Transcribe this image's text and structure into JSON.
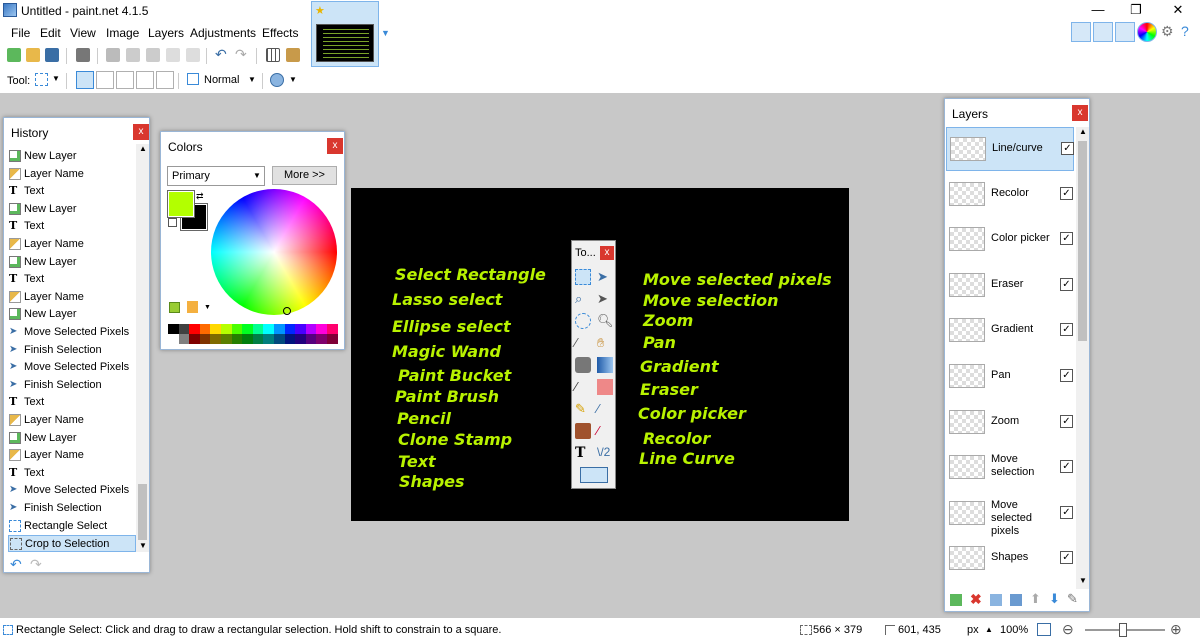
{
  "window": {
    "title": "Untitled - paint.net 4.1.5",
    "minimize": "—",
    "maximize": "❐",
    "close": "✕"
  },
  "menu": [
    "File",
    "Edit",
    "View",
    "Image",
    "Layers",
    "Adjustments",
    "Effects"
  ],
  "tool_options": {
    "tool_label": "Tool:",
    "blend_mode": "Normal"
  },
  "history": {
    "title": "History",
    "close": "x",
    "items": [
      {
        "label": "New Layer",
        "icon": "new-layer-icon"
      },
      {
        "label": "Layer Name",
        "icon": "layer-properties-icon"
      },
      {
        "label": "Text",
        "icon": "text-tool-icon"
      },
      {
        "label": "New Layer",
        "icon": "new-layer-icon"
      },
      {
        "label": "Text",
        "icon": "text-tool-icon"
      },
      {
        "label": "Layer Name",
        "icon": "layer-properties-icon"
      },
      {
        "label": "New Layer",
        "icon": "new-layer-icon"
      },
      {
        "label": "Text",
        "icon": "text-tool-icon"
      },
      {
        "label": "Layer Name",
        "icon": "layer-properties-icon"
      },
      {
        "label": "New Layer",
        "icon": "new-layer-icon"
      },
      {
        "label": "Move Selected Pixels",
        "icon": "move-selected-icon"
      },
      {
        "label": "Finish Selection",
        "icon": "finish-selection-icon"
      },
      {
        "label": "Move Selected Pixels",
        "icon": "move-selected-icon"
      },
      {
        "label": "Finish Selection",
        "icon": "finish-selection-icon"
      },
      {
        "label": "Text",
        "icon": "text-tool-icon"
      },
      {
        "label": "Layer Name",
        "icon": "layer-properties-icon"
      },
      {
        "label": "New Layer",
        "icon": "new-layer-icon"
      },
      {
        "label": "Layer Name",
        "icon": "layer-properties-icon"
      },
      {
        "label": "Text",
        "icon": "text-tool-icon"
      },
      {
        "label": "Move Selected Pixels",
        "icon": "move-selected-icon"
      },
      {
        "label": "Finish Selection",
        "icon": "finish-selection-icon"
      },
      {
        "label": "Rectangle Select",
        "icon": "rectangle-select-icon"
      },
      {
        "label": "Crop to Selection",
        "icon": "crop-icon",
        "selected": true
      }
    ]
  },
  "colors": {
    "title": "Colors",
    "close": "x",
    "mode": "Primary",
    "more_button": "More >>",
    "primary": "#b3ff00",
    "secondary": "#000000",
    "palette": [
      "#000000",
      "#404040",
      "#ff0000",
      "#ff6a00",
      "#ffd800",
      "#b6ff00",
      "#4cff00",
      "#00ff21",
      "#00ff90",
      "#00ffff",
      "#0094ff",
      "#0026ff",
      "#4800ff",
      "#b200ff",
      "#ff00dc",
      "#ff006e",
      "#ffffff",
      "#808080",
      "#7f0000",
      "#7f3300",
      "#7f6a00",
      "#5b7f00",
      "#267f00",
      "#007f0e",
      "#007f46",
      "#007f7f",
      "#004a7f",
      "#00137f",
      "#21007f",
      "#57007f",
      "#7f006e",
      "#7f0037"
    ]
  },
  "canvas_text": {
    "left": [
      "Select Rectangle",
      "Lasso select",
      "Ellipse  select",
      "Magic Wand",
      "Paint Bucket",
      "Paint Brush",
      "Pencil",
      "Clone Stamp",
      "Text",
      "Shapes"
    ],
    "right": [
      "Move selected pixels",
      "Move selection",
      "Zoom",
      "Pan",
      "Gradient",
      "Eraser",
      "Color picker",
      "Recolor",
      "Line Curve"
    ]
  },
  "tools_window": {
    "title": "To...",
    "close": "x"
  },
  "layers": {
    "title": "Layers",
    "close": "x",
    "items": [
      {
        "name": "Line/curve",
        "visible": true,
        "selected": true
      },
      {
        "name": "Recolor",
        "visible": true
      },
      {
        "name": "Color picker",
        "visible": true
      },
      {
        "name": "Eraser",
        "visible": true
      },
      {
        "name": "Gradient",
        "visible": true
      },
      {
        "name": "Pan",
        "visible": true
      },
      {
        "name": "Zoom",
        "visible": true
      },
      {
        "name": "Move selection",
        "visible": true
      },
      {
        "name": "Move selected pixels",
        "visible": true
      },
      {
        "name": "Shapes",
        "visible": true
      }
    ]
  },
  "status": {
    "hint": "Rectangle Select: Click and drag to draw a rectangular selection. Hold shift to constrain to a square.",
    "size": "566 × 379",
    "position": "601, 435",
    "units": "px",
    "zoom": "100%"
  },
  "accent": "#3a8ad8",
  "canvas_text_color": "#b8f200"
}
